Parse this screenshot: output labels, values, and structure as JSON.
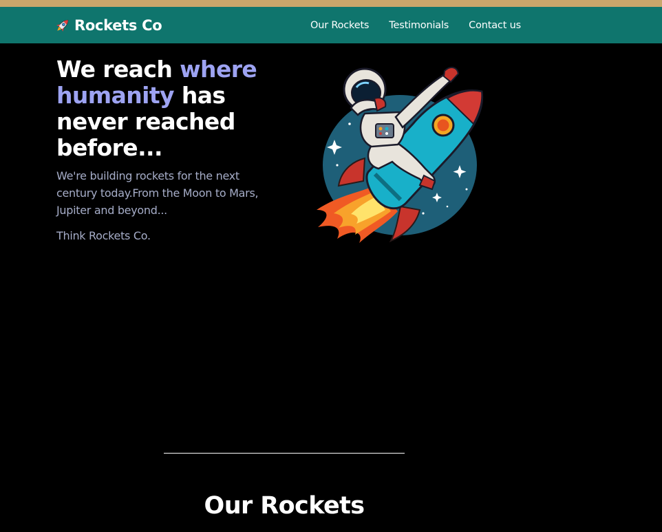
{
  "brand": {
    "name": "Rockets Co",
    "icon": "rocket-icon"
  },
  "nav": {
    "links": [
      {
        "label": "Our Rockets"
      },
      {
        "label": "Testimonials"
      },
      {
        "label": "Contact us"
      }
    ]
  },
  "hero": {
    "title_part1": "We reach ",
    "title_accent": "where humanity",
    "title_part2": " has never reached before...",
    "subtitle": "We're building rockets for the next century today.From the Moon to Mars, Jupiter and beyond...",
    "tagline": "Think Rockets Co.",
    "illustration": "astronaut-riding-rocket-illustration"
  },
  "sections": {
    "rockets_title": "Our Rockets"
  },
  "colors": {
    "top_strip": "#c9a66b",
    "navbar": "#0f756d",
    "background": "#000000",
    "accent": "#9da3f2",
    "muted_text": "#a6adc8"
  }
}
